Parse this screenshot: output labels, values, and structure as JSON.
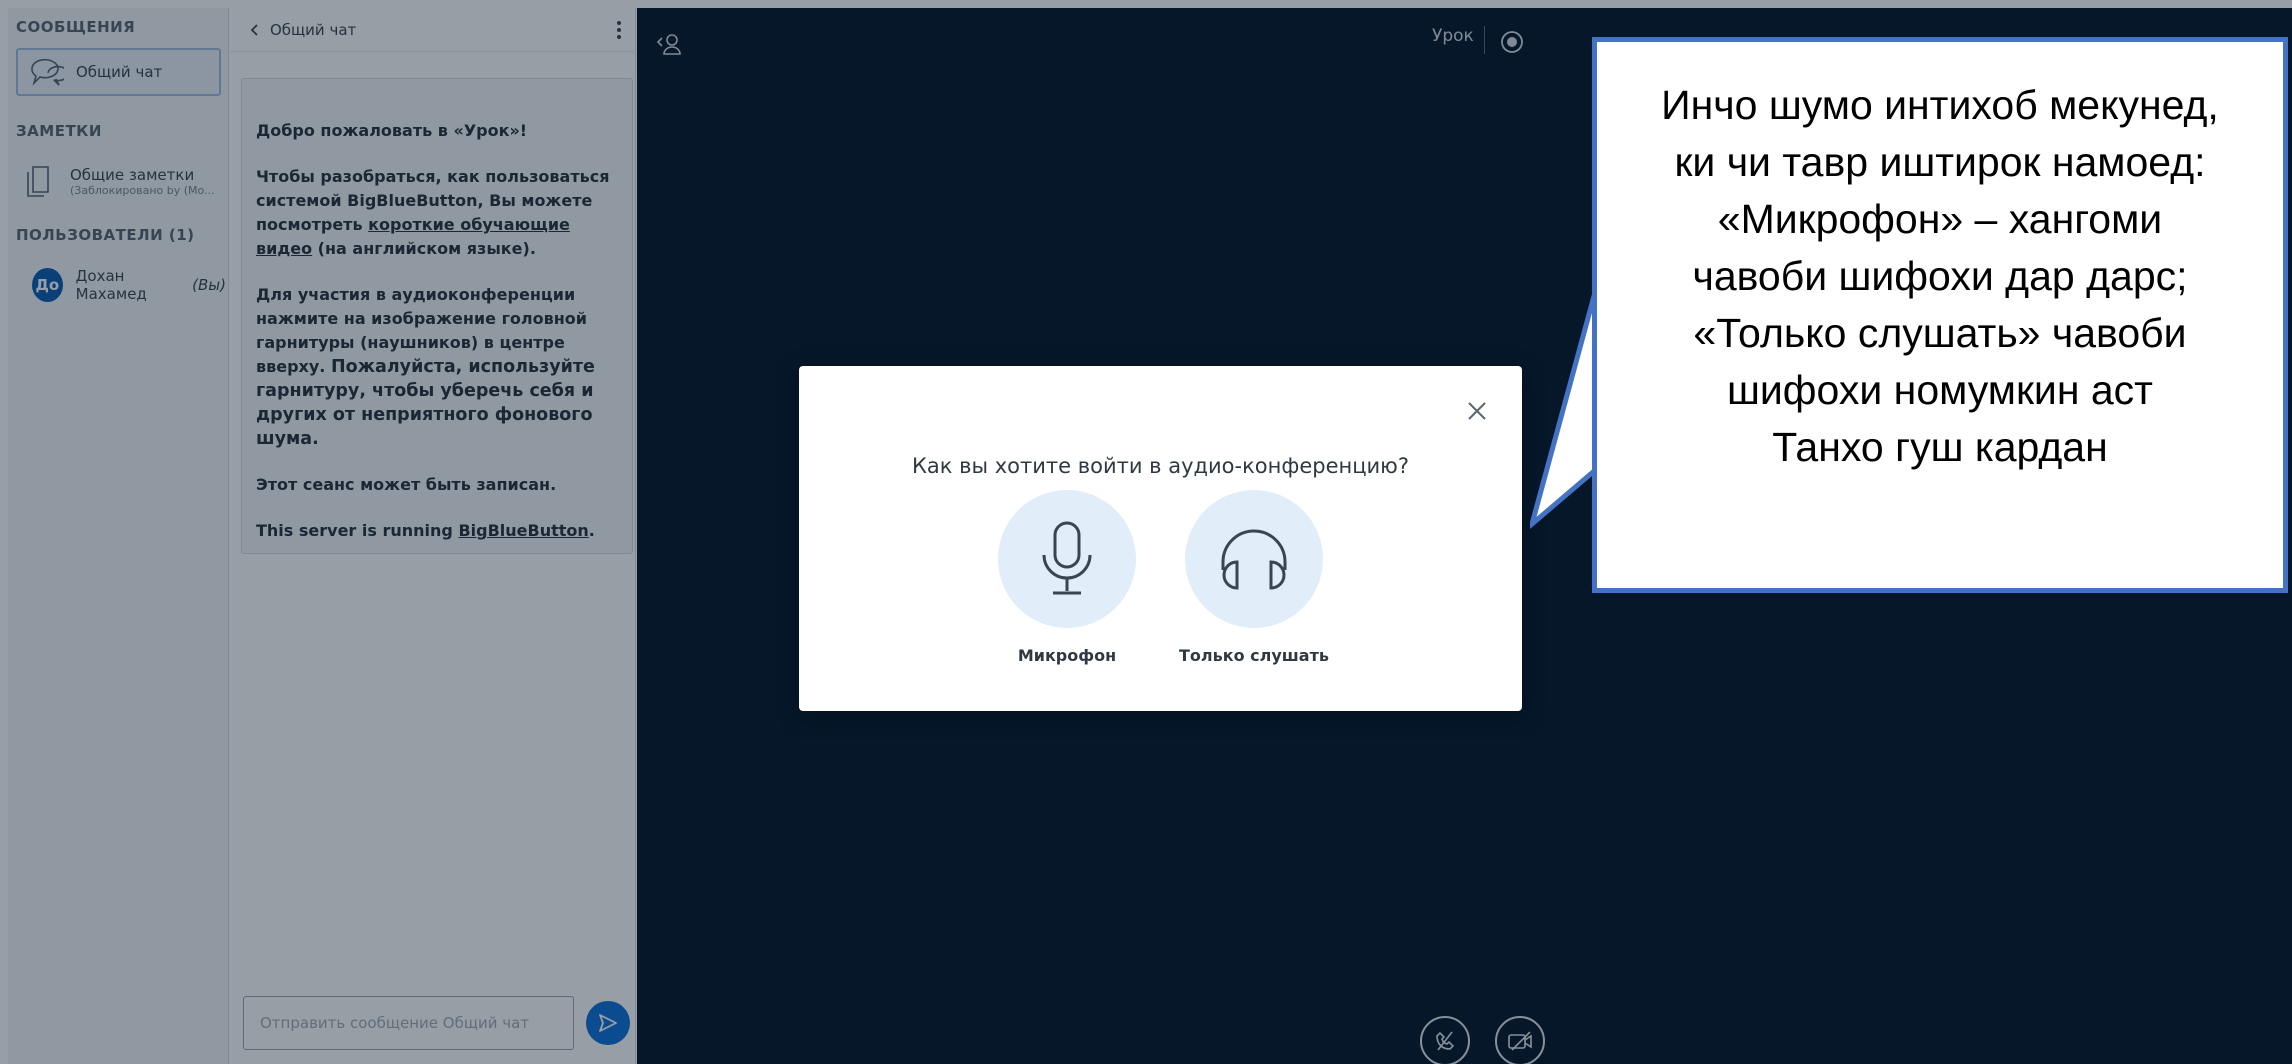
{
  "sidebar": {
    "messages_heading": "СООБЩЕНИЯ",
    "public_chat": "Общий чат",
    "notes_heading": "ЗАМЕТКИ",
    "shared_notes": "Общие заметки",
    "shared_notes_sub": "(Заблокировано by (Mo...",
    "users_heading": "ПОЛЬЗОВАТЕЛИ (1)",
    "user_initials": "До",
    "user_name": "Дохан Махамед",
    "user_you": "(Вы)"
  },
  "chat": {
    "title": "Общий чат",
    "welcome_1_pre": "Добро пожаловать в «",
    "welcome_1_room": "Урок",
    "welcome_1_post": "»!",
    "welcome_2_pre": "Чтобы разобраться, как пользоваться системой BigBlueButton, Вы можете посмотреть ",
    "welcome_2_link": "короткие обучающие видео",
    "welcome_2_post": " (на английском языке).",
    "welcome_3": "Для участия в аудиоконференции нажмите на изображение головной гарнитуры (наушников) в центре вверху.",
    "welcome_3_bold": "Пожалуйста, используйте гарнитуру, чтобы уберечь себя и других от неприятного фонового шума.",
    "welcome_4": "Этот сеанс может быть записан.",
    "welcome_5_pre": "This server is running ",
    "welcome_5_link": "BigBlueButton",
    "welcome_5_post": ".",
    "input_placeholder": "Отправить сообщение Общий чат"
  },
  "stage": {
    "title": "Урок"
  },
  "modal": {
    "question": "Как вы хотите войти в аудио-конференцию?",
    "microphone": "Микрофон",
    "listen_only": "Только слушать"
  },
  "callout": {
    "lines": [
      "Инчо шумо интихоб мекунед,",
      "ки чи тавр иштирок намоед:",
      "«Микрофон» – хангоми",
      "чавоби шифохи дар дарс;",
      "«Только слушать» чавоби",
      "шифохи номумкин аст",
      "Танхо гуш кардан"
    ]
  },
  "colors": {
    "stage_bg": "#06172a",
    "accent": "#0f70d7",
    "callout_border": "#4472c4"
  }
}
